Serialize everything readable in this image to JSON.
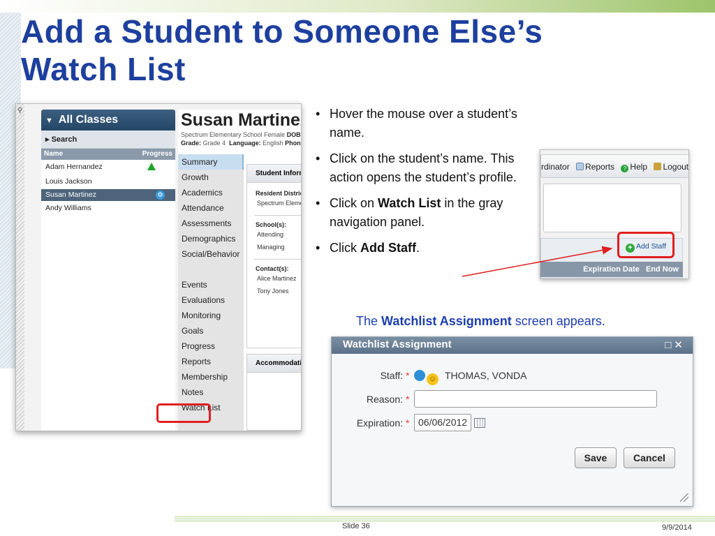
{
  "slide": {
    "title_line1": "Add a Student to Someone Else’s",
    "title_line2": "Watch List",
    "slide_number": "Slide 36",
    "date": "9/9/2014"
  },
  "profile_screenshot": {
    "classes_title": "All Classes",
    "search_label": "Search",
    "col_name": "Name",
    "col_progress": "Progress",
    "students": [
      "Adam Hernandez",
      "Louis Jackson",
      "Susan Martinez",
      "Andy Williams"
    ],
    "student_name": "Susan Martinez",
    "meta_line1": "Spectrum Elementary School  Female",
    "meta_dob_label": "DOB:",
    "meta_grade_label": "Grade:",
    "meta_grade_value": "Grade 4",
    "meta_language_label": "Language:",
    "meta_language_value": "English",
    "meta_phone_label": "Phon",
    "nav_items": [
      "Summary",
      "Growth",
      "Academics",
      "Attendance",
      "Assessments",
      "Demographics",
      "Social/Behavior",
      "Events",
      "Evaluations",
      "Monitoring",
      "Goals",
      "Progress Reports",
      "Membership",
      "Notes",
      "Watch List"
    ],
    "info_header": "Student Informatio",
    "resident_label": "Resident District(s):",
    "resident_value": "Spectrum Elementar",
    "school_label": "School(s):",
    "school_values": [
      "Attending",
      "Managing"
    ],
    "contact_label": "Contact(s):",
    "contact_values": [
      "Alice Martinez",
      "Tony Jones"
    ],
    "accommodations_header": "Accommodations"
  },
  "menu_screenshot": {
    "menu_coordinator": "rdinator",
    "menu_reports": "Reports",
    "menu_help": "Help",
    "menu_logout": "Logout",
    "add_staff": "Add Staff",
    "col_expiration": "Expiration Date",
    "col_end_now": "End Now"
  },
  "bullets": {
    "b1": "Hover the mouse over a student’s name.",
    "b2": "Click on the student’s name. This action opens the student’s profile.",
    "b3_pre": "Click on ",
    "b3_bold": "Watch List",
    "b3_post": " in the gray navigation panel.",
    "b4_pre": "Click ",
    "b4_bold": "Add Staff",
    "b4_post": "."
  },
  "caption": {
    "pre": "The ",
    "bold": "Watchlist Assignment",
    "post": " screen appears."
  },
  "dialog": {
    "title": "Watchlist Assignment",
    "staff_label": "Staff:",
    "staff_value": "THOMAS, VONDA",
    "reason_label": "Reason:",
    "reason_value": "",
    "expiration_label": "Expiration:",
    "expiration_value": "06/06/2012",
    "save_label": "Save",
    "cancel_label": "Cancel",
    "required_mark": "*"
  },
  "colors": {
    "title": "#1d3f9e",
    "highlight_red": "#e01f1f",
    "caption_blue": "#1d3fae"
  }
}
